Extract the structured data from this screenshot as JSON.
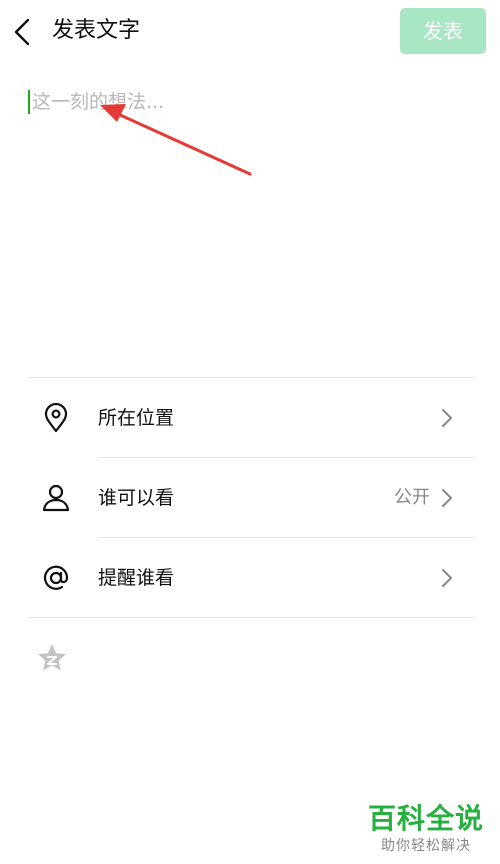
{
  "header": {
    "title": "发表文字",
    "publish_label": "发表"
  },
  "compose": {
    "placeholder": "这一刻的想法..."
  },
  "options": [
    {
      "label": "所在位置",
      "value": "",
      "icon": "location-pin-icon"
    },
    {
      "label": "谁可以看",
      "value": "公开",
      "icon": "person-icon"
    },
    {
      "label": "提醒谁看",
      "value": "",
      "icon": "at-sign-icon"
    }
  ],
  "colors": {
    "publish_disabled": "#a9e6c4",
    "caret": "#1aad19",
    "annotation_arrow": "#e53935",
    "watermark": "#27b040"
  },
  "watermark": {
    "title": "百科全说",
    "subtitle": "助你轻松解决"
  }
}
